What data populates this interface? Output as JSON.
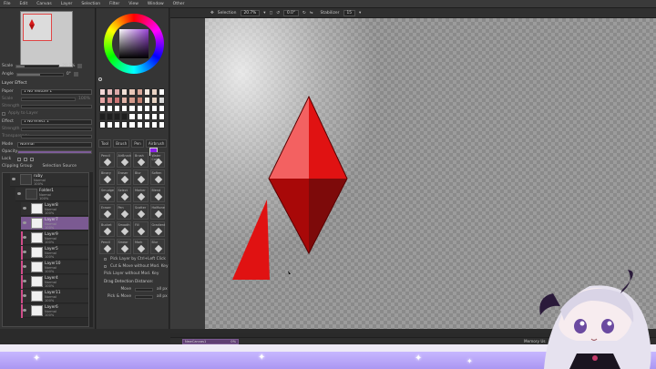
{
  "menu": [
    "File",
    "Edit",
    "Canvas",
    "Layer",
    "Selection",
    "Filter",
    "View",
    "Window",
    "Other"
  ],
  "left": {
    "scale_label": "Scale",
    "scale_value": "20.7%",
    "angle_label": "Angle",
    "angle_value": "0°",
    "layer_effect": {
      "title": "Layer Effect",
      "paper_label": "Paper",
      "paper_value": "1 No Texture 1",
      "scale_label": "Scale",
      "scale_value": "100%",
      "strength_label": "Strength",
      "apply_label": "Apply to Layer",
      "effect_label": "Effect",
      "effect_value": "1 No effect 1",
      "strength2_label": "Strength",
      "transp_label": "Transparency"
    },
    "mode_label": "Mode",
    "mode_value": "Normal",
    "opacity_label": "Opacity",
    "opacity_value": "100%",
    "lock_label": "Lock",
    "clipping_label": "Clipping Group",
    "selection_source_label": "Selection Source",
    "layers": [
      {
        "name": "ruby",
        "mode": "Normal",
        "pct": "100%",
        "kind": "folder"
      },
      {
        "name": "Folder1",
        "mode": "Normal",
        "pct": "100%",
        "kind": "folder"
      },
      {
        "name": "Layer8",
        "mode": "Normal",
        "pct": "100%",
        "kind": "layer"
      },
      {
        "name": "Layer7",
        "mode": "Normal",
        "pct": "100%",
        "kind": "selected"
      },
      {
        "name": "Layer9",
        "mode": "Normal",
        "pct": "100%",
        "kind": "tagged"
      },
      {
        "name": "Layer5",
        "mode": "Normal",
        "pct": "100%",
        "kind": "tagged"
      },
      {
        "name": "Layer10",
        "mode": "Normal",
        "pct": "100%",
        "kind": "tagged"
      },
      {
        "name": "Layer4",
        "mode": "Normal",
        "pct": "100%",
        "kind": "tagged"
      },
      {
        "name": "Layer11",
        "mode": "Normal",
        "pct": "100%",
        "kind": "tagged"
      },
      {
        "name": "Layer6",
        "mode": "Normal",
        "pct": "100%",
        "kind": "tagged"
      }
    ]
  },
  "tools": {
    "tabs": [
      "Tool",
      "Brush",
      "Pen",
      "Airbrush"
    ],
    "items": [
      "Pencil",
      "AirBrush",
      "Brush",
      "Water Color",
      "Binary",
      "Eraser",
      "Blur",
      "Soften",
      "Smudge",
      "Select",
      "Marker",
      "Blend",
      "Eraser",
      "Pen",
      "Scatter",
      "Halftone",
      "Bucket",
      "Smooth",
      "Fill",
      "Gradient",
      "Pencil",
      "Smear",
      "Mark",
      "Blur"
    ],
    "options": {
      "pick_layer": "Pick Layer by Ctrl+Left Click",
      "cut_move": "Cut & Move without Mod. Key",
      "pick_layer2": "Pick Layer without Mod. Key",
      "drag_label": "Drag Detection Distance:",
      "move_label": "Move",
      "move_value": "all px",
      "pick_label": "Pick & Move",
      "pick_value": "all px"
    },
    "swatch_colors": [
      "#f2d6d6",
      "#e9bfbf",
      "#dca9a9",
      "#f0e0d6",
      "#e8c7b8",
      "#d9a99a",
      "#f4e7dd",
      "#ead3c4",
      "#ffffff",
      "#e6a3a3",
      "#d98c8c",
      "#cc7474",
      "#e0b3a6",
      "#d49a8b",
      "#c58172",
      "#f8efe6",
      "#e6d2c2",
      "#d9d9d9",
      "#ffffff",
      "#ffffff",
      "#ffffff",
      "#ffffff",
      "#ffffff",
      "#ffffff",
      "#ffffff",
      "#ffffff",
      "#ffffff",
      "#1e1e1e",
      "#1e1e1e",
      "#1e1e1e",
      "#1e1e1e",
      "#ffffff",
      "#ffffff",
      "#ffffff",
      "#ffffff",
      "#ffffff",
      "#ffffff",
      "#ffffff",
      "#ffffff",
      "#ffffff",
      "#ffffff",
      "#ffffff",
      "#ffffff",
      "#ffffff",
      "#ffffff"
    ]
  },
  "canvas": {
    "selection_label": "Selection",
    "selection_zoom": "20.7%",
    "angle": "0.0°",
    "stabilizer_label": "Stabilizer",
    "stabilizer_value": "15",
    "shape_colors": {
      "light": "#f36161",
      "mid": "#e01212",
      "dark": "#a80808",
      "shadow": "#7d0a0a"
    }
  },
  "status": {
    "file": "NewCanvas1",
    "file_pct": "0%",
    "memory": "Memory Us",
    "zoom": "%"
  },
  "overlay": {
    "colors": {
      "bar": "#b7a6f8",
      "top": "#eeeaf6"
    }
  }
}
